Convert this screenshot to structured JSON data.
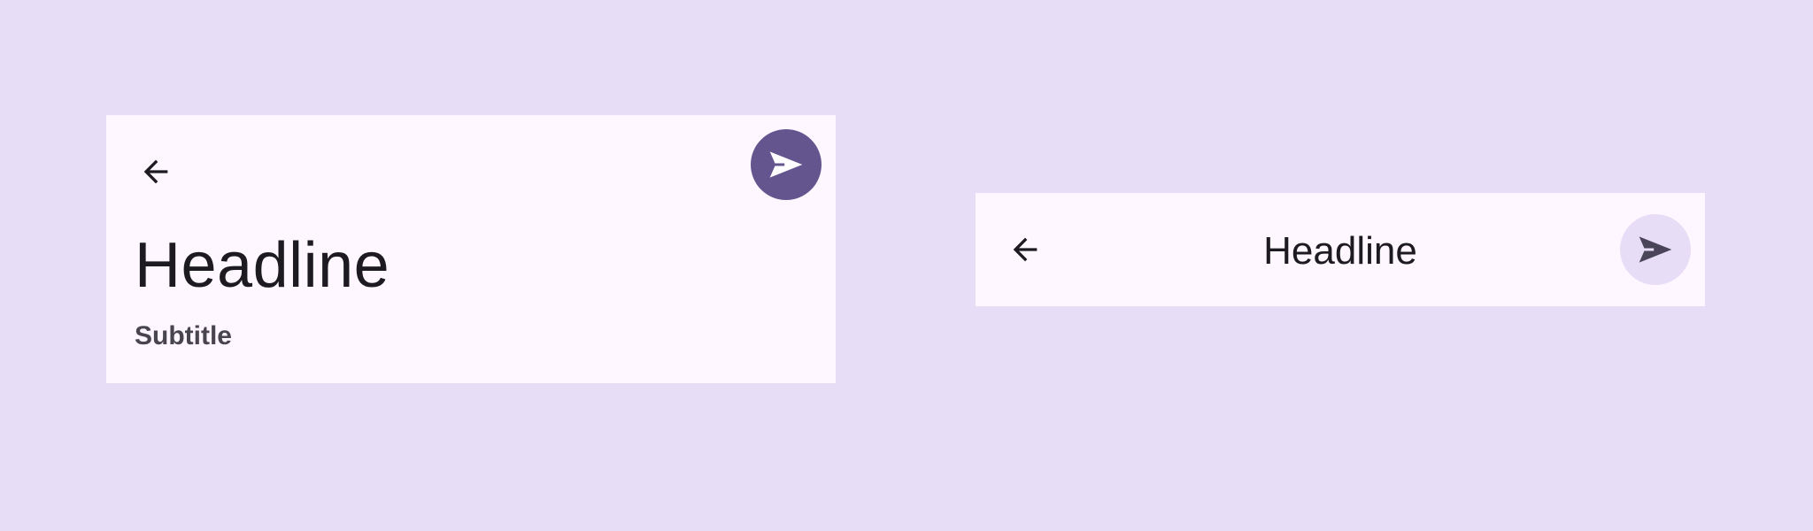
{
  "large_app_bar": {
    "headline": "Headline",
    "subtitle": "Subtitle",
    "nav_icon": "arrow-back-icon",
    "action_icon": "send-icon"
  },
  "center_app_bar": {
    "headline": "Headline",
    "nav_icon": "arrow-back-icon",
    "action_icon": "send-icon"
  },
  "colors": {
    "background": "#e8ddf6",
    "surface": "#fef7ff",
    "primary": "#65558f",
    "on_surface": "#1d1b20",
    "on_surface_variant": "#49454f",
    "tonal_container": "#e8ddf6",
    "on_tonal": "#4a4458"
  }
}
